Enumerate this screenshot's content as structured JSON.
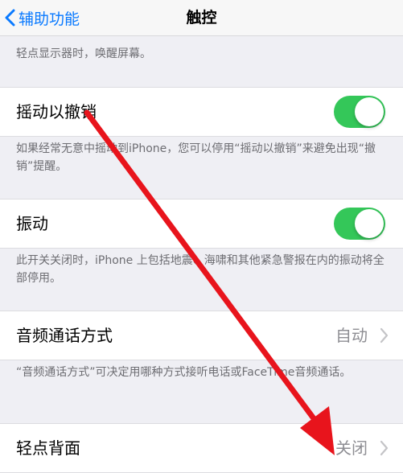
{
  "nav": {
    "back_label": "辅助功能",
    "title": "触控"
  },
  "footers": {
    "wake": "轻点显示器时，唤醒屏幕。",
    "shake": "如果经常无意中摇动到iPhone，您可以停用“摇动以撤销”来避免出现“撤销”提醒。",
    "vibration": "此开关关闭时，iPhone 上包括地震、海啸和其他紧急警报在内的振动将全部停用。",
    "call_audio": "“音频通话方式”可决定用哪种方式接听电话或FaceTime音频通话。"
  },
  "settings": {
    "shake_to_undo": {
      "label": "摇动以撤销",
      "on": true
    },
    "vibration": {
      "label": "振动",
      "on": true
    },
    "call_audio_routing": {
      "label": "音频通话方式",
      "value": "自动"
    },
    "back_tap": {
      "label": "轻点背面",
      "value": "关闭"
    }
  },
  "colors": {
    "accent": "#0a7aff",
    "toggle_on": "#34c759",
    "annotation_arrow": "#e8141c"
  }
}
